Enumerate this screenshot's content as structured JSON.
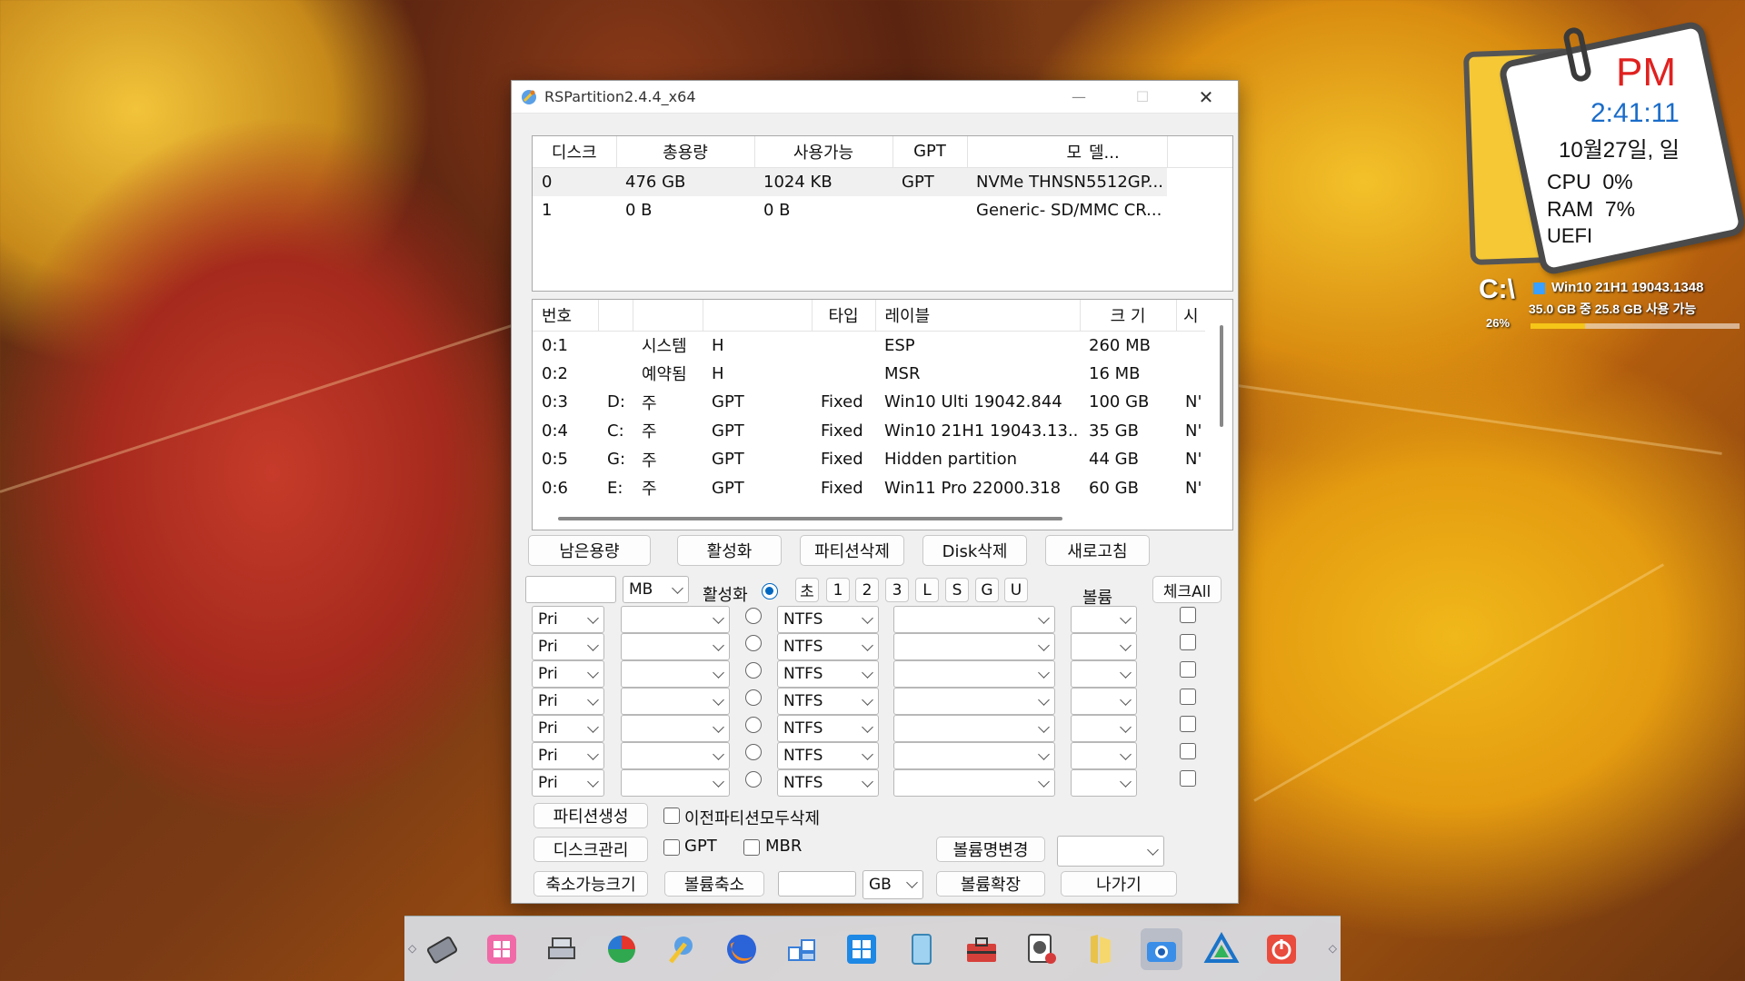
{
  "window": {
    "title": "RSPartition2.4.4_x64",
    "minimize": "—",
    "maximize": "☐",
    "close": "✕"
  },
  "disk_table": {
    "headers": [
      "디스크",
      "총용량",
      "사용가능",
      "GPT",
      "모",
      "델..."
    ],
    "rows": [
      [
        "0",
        "476 GB",
        "1024 KB",
        "GPT",
        "NVMe THNSN5512GP..."
      ],
      [
        "1",
        "0 B",
        "0 B",
        "",
        "Generic- SD/MMC CR..."
      ]
    ]
  },
  "part_table": {
    "headers": [
      "번호",
      "",
      "",
      "",
      "타입",
      "레이블",
      "크 기",
      "시"
    ],
    "rows": [
      [
        "0:1",
        "",
        "시스템",
        "H",
        "",
        "ESP",
        "260 MB",
        ""
      ],
      [
        "0:2",
        "",
        "예약됨",
        "H",
        "",
        "MSR",
        "16 MB",
        ""
      ],
      [
        "0:3",
        "D:",
        "주",
        "GPT",
        "Fixed",
        "Win10 Ulti 19042.844",
        "100 GB",
        "N'"
      ],
      [
        "0:4",
        "C:",
        "주",
        "GPT",
        "Fixed",
        "Win10 21H1 19043.13...",
        "35 GB",
        "N'"
      ],
      [
        "0:5",
        "G:",
        "주",
        "GPT",
        "Fixed",
        "Hidden partition",
        "44 GB",
        "N'"
      ],
      [
        "0:6",
        "E:",
        "주",
        "GPT",
        "Fixed",
        "Win11 Pro 22000.318",
        "60 GB",
        "N'"
      ]
    ]
  },
  "buttons": {
    "remaining": "남은용량",
    "activate": "활성화",
    "delete_partition": "파티션삭제",
    "delete_disk": "Disk삭제",
    "refresh": "새로고침",
    "check_all": "체크All",
    "create_partition": "파티션생성",
    "disk_manage": "디스크관리",
    "shrinkable_size": "축소가능크기",
    "volume_shrink": "볼륨축소",
    "rename_volume": "볼륨명변경",
    "volume_extend": "볼륨확장",
    "exit": "나가기"
  },
  "controls": {
    "unit": "MB",
    "active_label": "활성화",
    "quick_buttons": [
      "초",
      "1",
      "2",
      "3",
      "L",
      "S",
      "G",
      "U"
    ],
    "volume_label": "볼륨",
    "row_types": [
      "Pri",
      "Pri",
      "Pri",
      "Pri",
      "Pri",
      "Pri",
      "Pri"
    ],
    "row_fs": [
      "NTFS",
      "NTFS",
      "NTFS",
      "NTFS",
      "NTFS",
      "NTFS",
      "NTFS"
    ],
    "delete_all_prev": "이전파티션모두삭제",
    "gpt": "GPT",
    "mbr": "MBR",
    "shrink_unit": "GB"
  },
  "widget": {
    "ampm": "PM",
    "time": "2:41:11",
    "date": "10월27일, 일",
    "cpu": "CPU  0%",
    "ram": "RAM  7%",
    "boot": "UEFI"
  },
  "sysinfo": {
    "drive": "C:\\",
    "percent": "26%",
    "os": "Win10 21H1 19043.1348",
    "space": "35.0 GB 중  25.8 GB 사용 가능",
    "used_fraction": 0.26
  }
}
